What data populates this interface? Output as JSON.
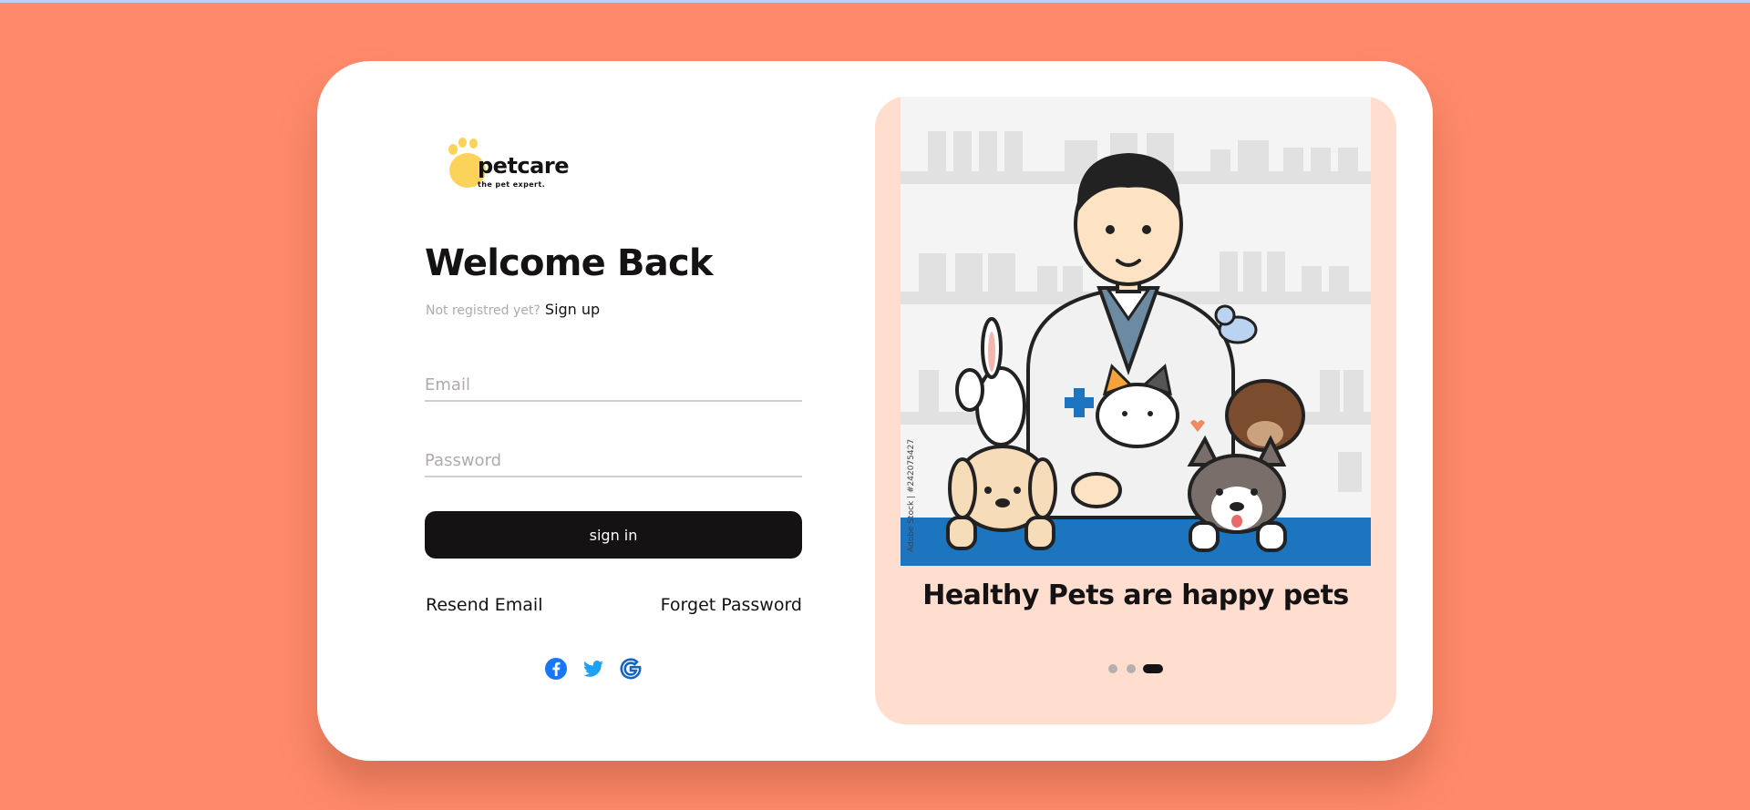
{
  "brand": {
    "name": "petcare",
    "tagline": "the pet expert."
  },
  "login": {
    "heading": "Welcome Back",
    "not_registered_text": "Not registred yet?",
    "signup_link": "Sign up",
    "email_placeholder": "Email",
    "password_placeholder": "Password",
    "signin_label": "sign in",
    "resend_email_link": "Resend Email",
    "forget_password_link": "Forget Password",
    "social_icons": [
      "facebook-icon",
      "twitter-icon",
      "google-icon"
    ]
  },
  "carousel": {
    "caption": "Healthy Pets are happy pets",
    "image_watermark": "Adobe Stock | #242075427",
    "slide_count": 3,
    "active_slide": 3
  },
  "colors": {
    "background": "#ff8a6b",
    "panel": "#ffded0",
    "primary": "#141212",
    "brand_yellow": "#fcd35a",
    "facebook": "#1877f2",
    "twitter": "#1da1f2",
    "google": "#1565c0"
  }
}
